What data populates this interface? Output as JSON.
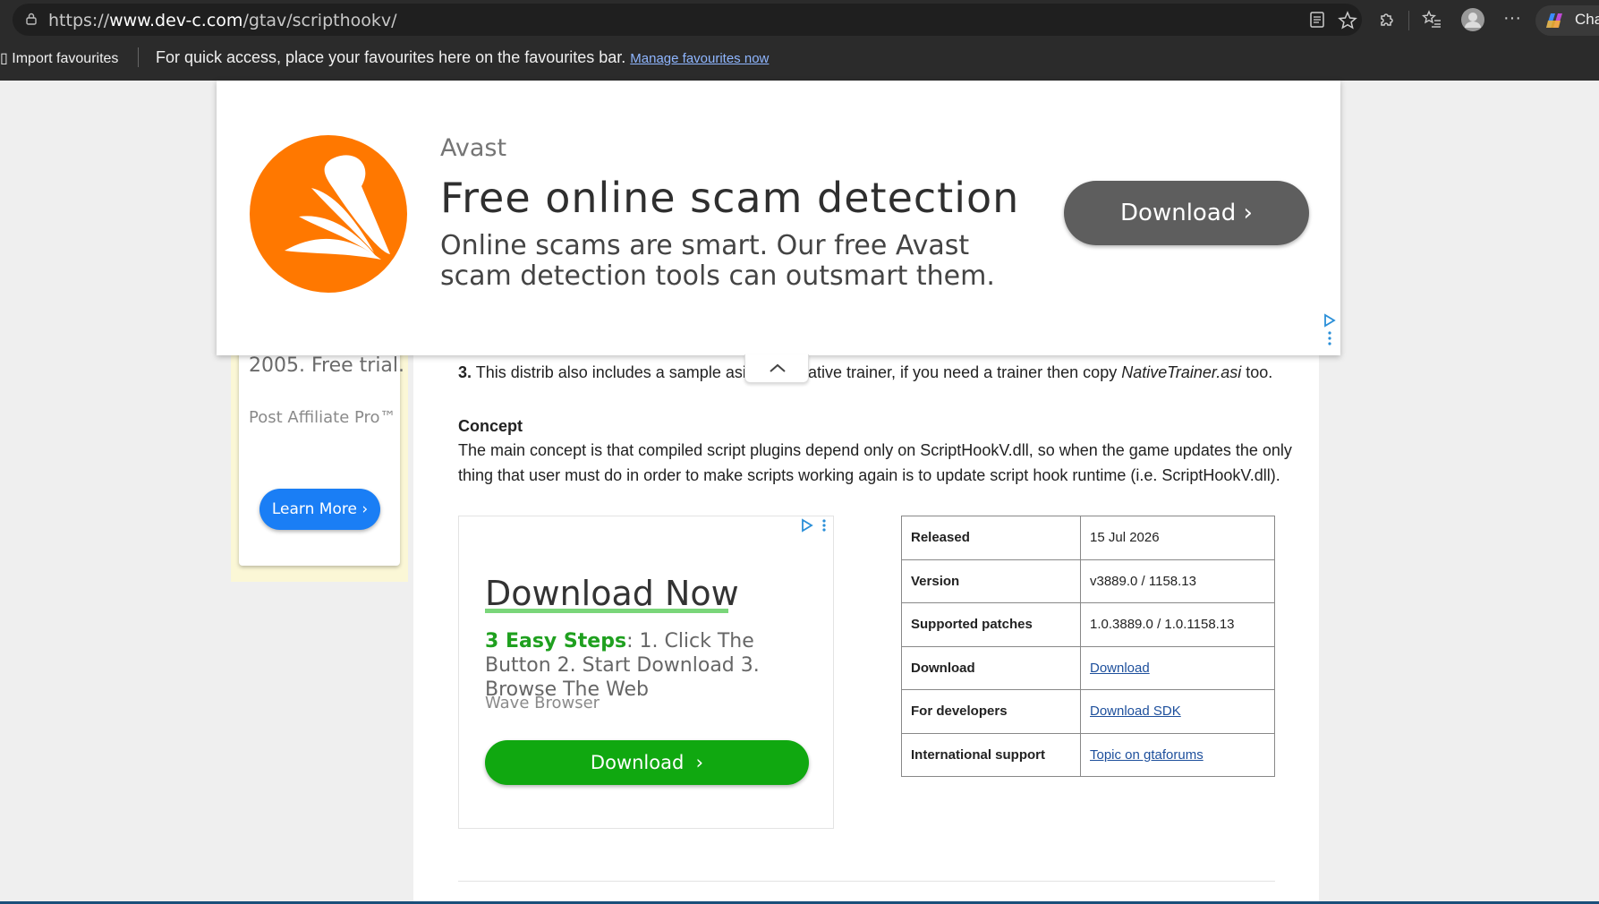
{
  "browser": {
    "url_prefix": "https://",
    "url_host": "www.dev-c.com",
    "url_path": "/gtav/scripthookv/",
    "copilot_label": "Chat",
    "favbar": {
      "import_label": "Import favourites",
      "message": "For quick access, place your favourites here on the favourites bar. ",
      "manage_link": "Manage favourites now"
    }
  },
  "top_ad": {
    "brand": "Avast",
    "headline": "Free online scam detection",
    "body": "Online scams are smart. Our free Avast scam detection tools can outsmart them.",
    "button_label": "Download",
    "brand_color": "#ff7800"
  },
  "left_ad": {
    "partial_text": "2005. Free trial.",
    "brand": "Post Affiliate Pro™",
    "button_label": "Learn More"
  },
  "article": {
    "item3_num": "3.",
    "item3_left": "This distrib also includes a sample asi",
    "item3_right_start": "ative trainer, if you need a trainer then copy ",
    "item3_file": "NativeTrainer.asi",
    "item3_end": " too.",
    "concept_heading": "Concept",
    "concept_line1": "The main concept is that compiled script plugins depend only on ScriptHookV.dll, so when the game updates the only",
    "concept_line2": "thing that user must do in order to make scripts working again is to update script hook runtime (i.e. ScriptHookV.dll)."
  },
  "download_ad": {
    "title": "Download Now",
    "steps_highlight": "3 Easy Steps",
    "steps_text": ": 1. Click The Button 2. Start Download 3. Browse The Web",
    "brand": "Wave Browser",
    "button_label": "Download"
  },
  "info_table": {
    "rows": [
      {
        "key": "Released",
        "value": "15 Jul 2026",
        "link": false
      },
      {
        "key": "Version",
        "value": "v3889.0 / 1158.13",
        "link": false
      },
      {
        "key": "Supported patches",
        "value": "1.0.3889.0 / 1.0.1158.13",
        "link": false
      },
      {
        "key": "Download",
        "value": "Download",
        "link": true
      },
      {
        "key": "For developers",
        "value": "Download SDK",
        "link": true
      },
      {
        "key": "International support",
        "value": "Topic on gtaforums",
        "link": true
      }
    ]
  }
}
